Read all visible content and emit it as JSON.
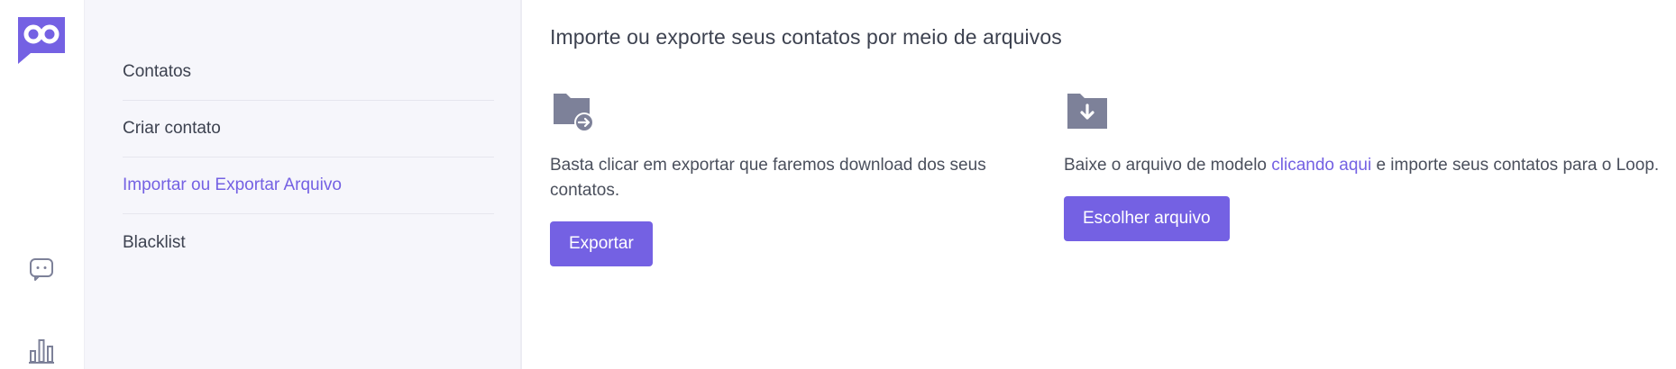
{
  "rail": {
    "logo": "loop-logo-icon",
    "icons": [
      "chat-icon",
      "bar-chart-icon"
    ]
  },
  "submenu": {
    "items": [
      {
        "label": "Contatos"
      },
      {
        "label": "Criar contato"
      },
      {
        "label": "Importar ou Exportar Arquivo"
      },
      {
        "label": "Blacklist"
      }
    ],
    "active": "Importar ou Exportar Arquivo"
  },
  "main": {
    "title": "Importe ou exporte seus contatos por meio de arquivos",
    "export": {
      "icon": "folder-export-icon",
      "description": "Basta clicar em exportar que faremos download dos seus contatos.",
      "button_label": "Exportar"
    },
    "import": {
      "icon": "folder-download-icon",
      "description_before": "Baixe o arquivo de modelo ",
      "link_label": "clicando aqui",
      "description_after": " e importe seus contatos para o Loop.",
      "button_label": "Escolher arquivo"
    }
  },
  "colors": {
    "accent": "#7461e3",
    "icon_gray": "#7d8199",
    "text": "#3d4250",
    "submenu_bg": "#f6f6fb"
  }
}
